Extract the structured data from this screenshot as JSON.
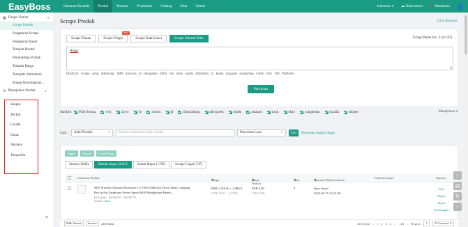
{
  "app": {
    "logo": "EasyBoss"
  },
  "nav": {
    "items": [
      "Halaman Beranda",
      "Produk",
      "Pesanan",
      "Pembelian",
      "Gudang",
      "Data",
      "Sistem"
    ],
    "active_index": 1
  },
  "topright": {
    "lang": "Indonesia ∨",
    "sync": "Sinkronisasi",
    "help": "Membantu",
    "lang_chev": "▾"
  },
  "sidebar": {
    "group1": {
      "label": "Fungsi Umum",
      "icon": "grid-icon"
    },
    "items": [
      "Scrape Produk",
      "Pengaturan Scrape",
      "Pengaturan Impor",
      "Templat Produk",
      "Pemindahan Produk",
      "Templat Harga",
      "Template Watermark",
      "Ruang Penyimpanan ..."
    ],
    "active_index": 0,
    "group2": {
      "label": "Manajemen Produk",
      "icon": "gear-icon"
    },
    "platforms": [
      "Shopee",
      "TikTok",
      "Lazada",
      "Daraz",
      "Akulaku",
      "Tokopedia"
    ],
    "collapse_icon": "≡"
  },
  "page": {
    "title": "Scrape Produk",
    "help_link": "Lihat Bantuan"
  },
  "scrape_tabs": [
    {
      "label": "Scrape Tautan",
      "active": false
    },
    {
      "label": "Scrape Plugin",
      "active": false,
      "badge": "HOT"
    },
    {
      "label": "Scrape Kata Kunci",
      "active": false
    },
    {
      "label": "Scrape Seluruh Toko",
      "active": true
    }
  ],
  "monthly": "Scrape Bulan Ini : 134/1354",
  "textarea": {
    "value": "Harga"
  },
  "platform_text": "Platform scrape yang didukung 1688  amazon  jd  tokopedia  blibli  tiki  ebay  sendo  jdIndofia  zz  kaola  mogujie  mazhaltao Lebih dari 100 Platform",
  "collect_button": "Pencarian",
  "filter": {
    "label": "Sumber:",
    "items": [
      "Pilih Semua",
      "vvic",
      "zhyw",
      "3e",
      "ecenix",
      "jd",
      "shenjiahong",
      "aliexpress",
      "sendo",
      "amazon",
      "ozon",
      "ebay",
      "yangkeduo",
      "lazada",
      "shopee"
    ],
    "right": "Manajemen w"
  },
  "search": {
    "label": "Cari:",
    "field": "Judul Produk",
    "placeholder": "Silakan masukkan judul produk",
    "mode": "Pencarian Luas",
    "button_icon": "Cari",
    "sort_link": "Pencarian tingkat tinggi"
  },
  "actions": [
    "Impor",
    "Hapus",
    "Coba Ulang"
  ],
  "status_tabs": [
    {
      "label": "Semua (4946)",
      "active": false
    },
    {
      "label": "Belum Impor (2453)",
      "active": true
    },
    {
      "label": "Sudah Impor (1766)",
      "active": false
    },
    {
      "label": "Scrape Gagal (747)",
      "active": false
    }
  ],
  "table": {
    "headers": {
      "info": "Informasi Produk",
      "price": "Harga",
      "discount": "Harga Diskon",
      "stock": "Stok",
      "operator": "Operator/Waktu/Catatan",
      "platform": "Platform Impor",
      "ops": "Operasi"
    },
    "rows": [
      {
        "name": "M10 Wireless Earbuds Bluetooth 5.3 TWS 3500mAh Power Bank Charging Box in Ear Earphones Stereo Sports HiFi Headphones Heads...",
        "id": "ID Sumber : 405481187_1665083791",
        "store_label": "Sumber:",
        "store": "daraz",
        "price": "PKR 1,326.60 ~ 1,080.0",
        "price_sub": "CNY 32.91 ~ 127.83",
        "discount": "PKR 0.00",
        "discount_sub": "CNY 0.00",
        "stock": "6",
        "operator": "akun utama",
        "time": "2024-02-15 10:12:00",
        "ops": [
          "Edit",
          "Hapus",
          "Impor",
          "Keterangan"
        ]
      }
    ]
  },
  "footer": {
    "select_all": "Pilih Semua",
    "invert": "Inverse",
    "count": "2453 Item",
    "total": "2453 Item",
    "pages": [
      "1",
      "2",
      "3",
      "4",
      "...",
      "123"
    ],
    "prev": "‹",
    "next": "›",
    "goto_label": "Pergi ke",
    "goto_value": "1",
    "page_size": "20 halaman"
  }
}
